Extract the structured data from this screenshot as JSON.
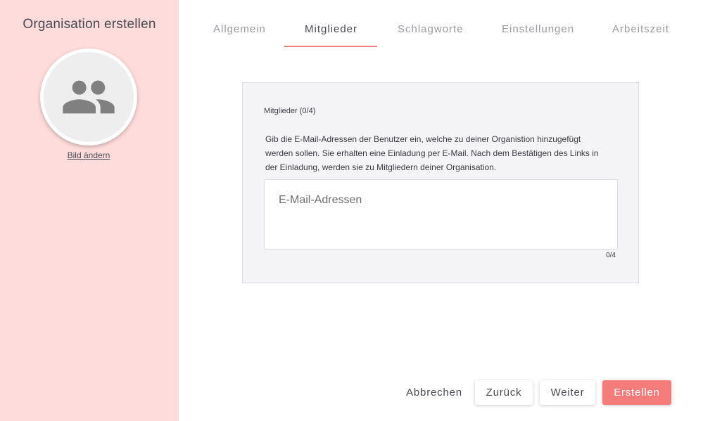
{
  "sidebar": {
    "title": "Organisation erstellen",
    "avatar_icon": "group-icon",
    "change_image_label": "Bild ändern",
    "background_color": "#ffdcdc"
  },
  "tabs": [
    {
      "label": "Allgemein",
      "active": false
    },
    {
      "label": "Mitglieder",
      "active": true
    },
    {
      "label": "Schlagworte",
      "active": false
    },
    {
      "label": "Einstellungen",
      "active": false
    },
    {
      "label": "Arbeitszeit",
      "active": false
    }
  ],
  "members": {
    "heading": "Mitglieder (0/4)",
    "description": "Gib die E-Mail-Adressen der Benutzer ein, welche zu deiner Organistion hinzugefügt werden sollen. Sie erhalten eine Einladung per E-Mail. Nach dem Bestätigen des Links in der Einladung, werden sie zu Mitgliedern deiner Organisation.",
    "email_placeholder": "E-Mail-Adressen",
    "email_value": "",
    "counter": "0/4"
  },
  "footer": {
    "cancel_label": "Abbrechen",
    "back_label": "Zurück",
    "next_label": "Weiter",
    "create_label": "Erstellen"
  },
  "colors": {
    "accent": "#f67c7c",
    "tab_underline": "#f08080"
  }
}
